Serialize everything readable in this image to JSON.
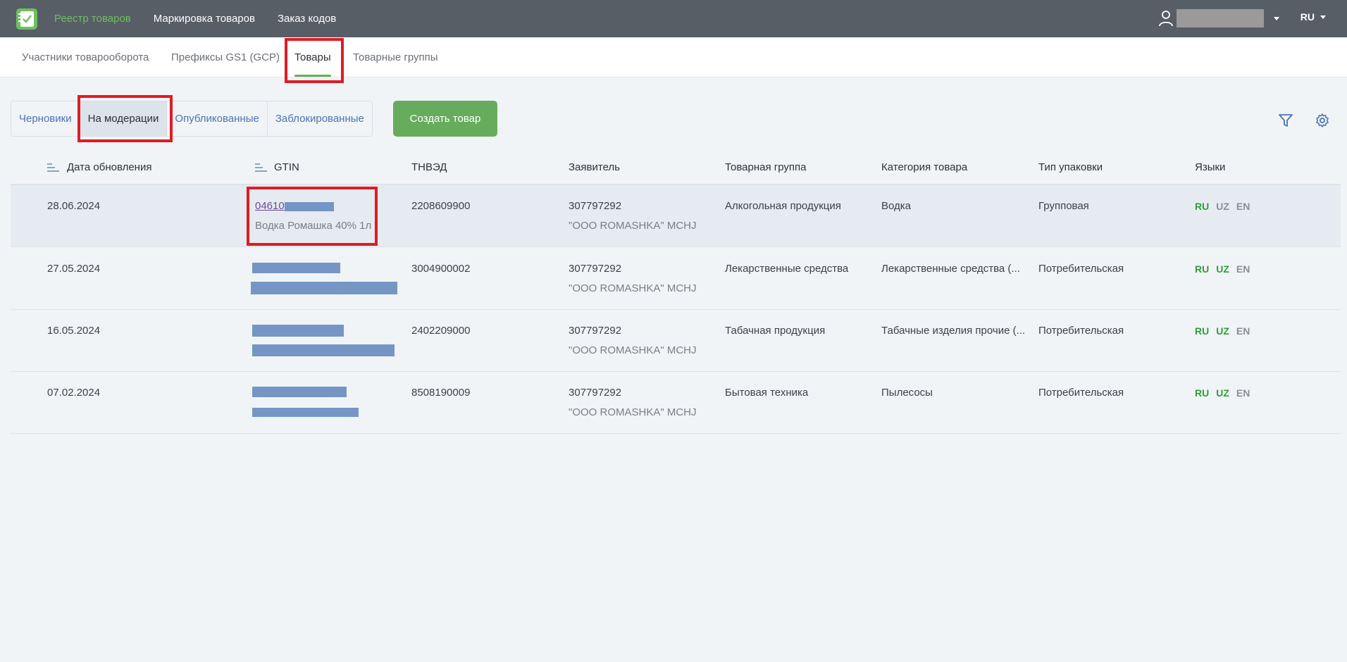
{
  "topbar": {
    "nav": [
      {
        "label": "Реестр товаров",
        "active": true
      },
      {
        "label": "Маркировка товаров",
        "active": false
      },
      {
        "label": "Заказ кодов",
        "active": false
      }
    ],
    "lang": "RU"
  },
  "subnav": {
    "tabs": [
      {
        "label": "Участники товарооборота"
      },
      {
        "label": "Префиксы GS1 (GCP)"
      },
      {
        "label": "Товары",
        "active": true
      },
      {
        "label": "Товарные группы"
      }
    ]
  },
  "status_filter": {
    "items": [
      "Черновики",
      "На модерации",
      "Опубликованные",
      "Заблокированные"
    ],
    "active": "На модерации"
  },
  "create_button": "Создать товар",
  "table": {
    "columns": [
      "Дата обновления",
      "GTIN",
      "ТНВЭД",
      "Заявитель",
      "Товарная группа",
      "Категория товара",
      "Тип упаковки",
      "Языки"
    ],
    "rows": [
      {
        "date": "28.06.2024",
        "gtin": "04610",
        "gtin_name": "Водка Ромашка 40% 1л",
        "tnved": "2208609900",
        "applicant_inn": "307797292",
        "applicant_name": "\"OOO ROMASHKA\" MCHJ",
        "group": "Алкогольная продукция",
        "category": "Водка",
        "packaging": "Групповая",
        "langs": [
          "RU",
          "UZ",
          "EN"
        ]
      },
      {
        "date": "27.05.2024",
        "gtin": "",
        "gtin_name": "",
        "tnved": "3004900002",
        "applicant_inn": "307797292",
        "applicant_name": "\"OOO ROMASHKA\" MCHJ",
        "group": "Лекарственные средства",
        "category": "Лекарственные средства (...",
        "packaging": "Потребительская",
        "langs": [
          "RU",
          "UZ",
          "EN"
        ]
      },
      {
        "date": "16.05.2024",
        "gtin": "",
        "gtin_name": "",
        "tnved": "2402209000",
        "applicant_inn": "307797292",
        "applicant_name": "\"OOO ROMASHKA\" MCHJ",
        "group": "Табачная продукция",
        "category": "Табачные изделия прочие (...",
        "packaging": "Потребительская",
        "langs": [
          "RU",
          "UZ",
          "EN"
        ]
      },
      {
        "date": "07.02.2024",
        "gtin": "",
        "gtin_name": "",
        "tnved": "8508190009",
        "applicant_inn": "307797292",
        "applicant_name": "\"OOO ROMASHKA\" MCHJ",
        "group": "Бытовая техника",
        "category": "Пылесосы",
        "packaging": "Потребительская",
        "langs": [
          "RU",
          "UZ",
          "EN"
        ]
      }
    ]
  },
  "colors": {
    "topbar": "#575e66",
    "accent_green": "#67ac5c",
    "link_blue": "#4a74b8",
    "highlight_red": "#e01b24"
  }
}
